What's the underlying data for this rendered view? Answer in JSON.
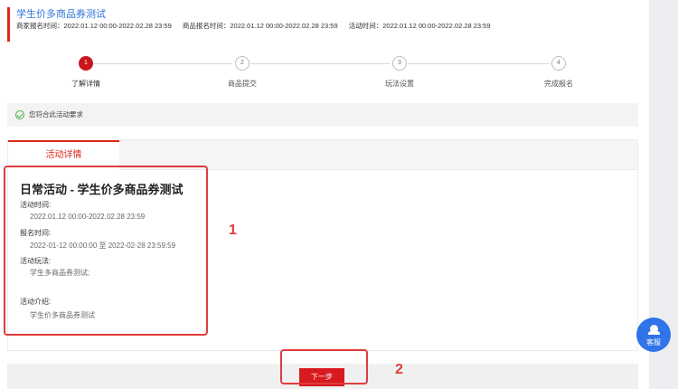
{
  "header": {
    "title": "学生价多商品券测试",
    "merchant_time": "商家报名时间：2022.01.12 00:00-2022.02.28 23:59",
    "product_time": "商品报名时间：2022.01.12 00:00-2022.02.28 23:59",
    "activity_time": "活动时间：2022.01.12 00:00-2022.02.28 23:59"
  },
  "steps": [
    {
      "num": "1",
      "label": "了解详情",
      "active": true
    },
    {
      "num": "2",
      "label": "商品提交",
      "active": false
    },
    {
      "num": "3",
      "label": "玩法设置",
      "active": false
    },
    {
      "num": "4",
      "label": "完成报名",
      "active": false
    }
  ],
  "notice": "您符合此活动要求",
  "tab": {
    "label": "活动详情"
  },
  "detail": {
    "title": "日常活动 - 学生价多商品券测试",
    "activity_time_label": "活动时间:",
    "activity_time_value": "2022.01.12 00:00-2022.02.28 23:59",
    "signup_time_label": "报名时间:",
    "signup_time_value": "2022-01-12 00:00:00 至 2022-02-28 23:59:59",
    "play_label": "活动玩法:",
    "play_value": "学生多商品券测试;",
    "intro_label": "活动介绍:",
    "intro_value": "学生价多商品券测试"
  },
  "annotations": {
    "box1": "1",
    "box2": "2"
  },
  "footer": {
    "next_label": "下一步"
  },
  "service": {
    "label": "客服"
  },
  "colors": {
    "accent": "#e1251b",
    "link": "#2f74d8",
    "service": "#2f74e8",
    "annotation": "#e03c3c"
  }
}
